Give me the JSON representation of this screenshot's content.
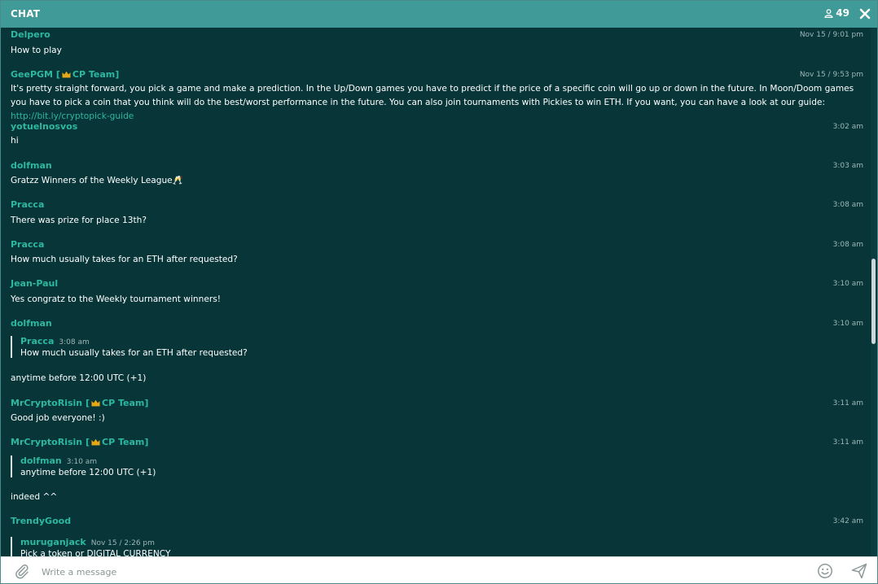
{
  "header": {
    "title": "CHAT",
    "online_count": "49",
    "user_icon": "user-icon",
    "close_icon": "close-icon"
  },
  "messages": [
    {
      "author": "Delpero",
      "time": "Nov 15 / 9:01 pm",
      "text": "How to play"
    },
    {
      "author": "GeePGM",
      "team": "CP Team",
      "time": "Nov 15 / 9:53 pm",
      "text": "It's pretty straight forward, you pick a game and make a prediction. In the Up/Down games you have to predict if the price of a specific coin will go up or down in the future. In Moon/Doom games you have to pick a coin that you think will do the best/worst performance in the future. You can also join tournaments with Pickies to win ETH. If you want, you can have a look at our guide:",
      "link": "http://bit.ly/cryptopick-guide"
    },
    {
      "author": "yotuelnosvos",
      "time": "3:02 am",
      "text": "hi"
    },
    {
      "author": "dolfman",
      "time": "3:03 am",
      "text": "Gratzz Winners of the Weekly League🥂"
    },
    {
      "author": "Pracca",
      "time": "3:08 am",
      "text": "There was prize for place 13th?"
    },
    {
      "author": "Pracca",
      "time": "3:08 am",
      "text": "How much usually takes for an ETH after requested?"
    },
    {
      "author": "Jean-Paul",
      "time": "3:10 am",
      "text": "Yes congratz to the Weekly tournament winners!"
    },
    {
      "author": "dolfman",
      "time": "3:10 am",
      "quote": {
        "author": "Pracca",
        "time": "3:08 am",
        "text": "How much usually takes for an ETH after requested?"
      },
      "text": "anytime before 12:00 UTC (+1)"
    },
    {
      "author": "MrCryptoRisin",
      "team": "CP Team",
      "time": "3:11 am",
      "text": "Good job everyone! :)"
    },
    {
      "author": "MrCryptoRisin",
      "team": "CP Team",
      "time": "3:11 am",
      "quote": {
        "author": "dolfman",
        "time": "3:10 am",
        "text": "anytime before 12:00 UTC (+1)"
      },
      "text": "indeed ^^"
    },
    {
      "author": "TrendyGood",
      "time": "3:42 am",
      "quote": {
        "author": "muruganjack",
        "time": "Nov 15 / 2:26 pm",
        "text": "Pick a token or DIGITAL CURRENCY"
      }
    }
  ],
  "composer": {
    "placeholder": "Write a message",
    "attach_icon": "paperclip-icon",
    "emoji_icon": "smiley-icon",
    "send_icon": "send-icon"
  },
  "colors": {
    "header_bg": "#3f9a98",
    "chat_bg": "#073538",
    "author": "#2eb8a0",
    "text": "#ffffff"
  }
}
